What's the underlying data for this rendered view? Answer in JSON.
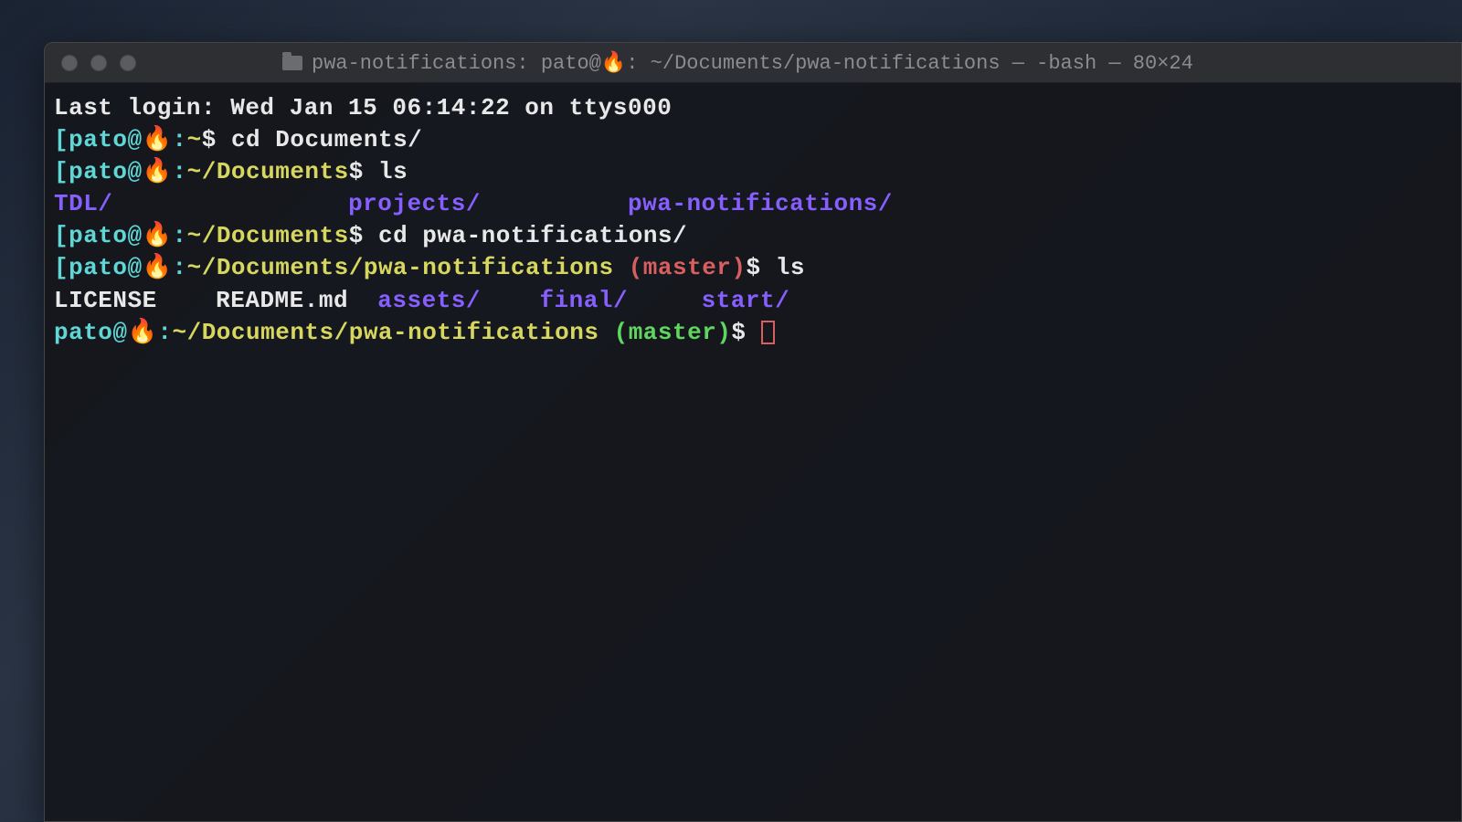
{
  "titlebar": {
    "title_prefix": "pwa-notifications: pato@",
    "fire_emoji": "🔥",
    "title_suffix": ": ~/Documents/pwa-notifications — -bash — 80×24"
  },
  "lines": {
    "last_login": "Last login: Wed Jan 15 06:14:22 on ttys000",
    "l1": {
      "bracket": "[",
      "user": "pato@",
      "emoji": "🔥",
      "colon": ":",
      "path": "~",
      "dollar": "$ ",
      "cmd": "cd Documents/"
    },
    "l2": {
      "bracket": "[",
      "user": "pato@",
      "emoji": "🔥",
      "colon": ":",
      "path": "~/Documents",
      "dollar": "$ ",
      "cmd": "ls"
    },
    "ls1": {
      "item1": "TDL/",
      "item2": "projects/",
      "item3": "pwa-notifications/",
      "sp1": "                ",
      "sp2": "          ",
      "sl": "/"
    },
    "l3": {
      "bracket": "[",
      "user": "pato@",
      "emoji": "🔥",
      "colon": ":",
      "path": "~/Documents",
      "dollar": "$ ",
      "cmd": "cd pwa-notifications/"
    },
    "l4": {
      "bracket": "[",
      "user": "pato@",
      "emoji": "🔥",
      "colon": ":",
      "path": "~/Documents/pwa-notifications",
      "branch": " (master)",
      "dollar": "$ ",
      "cmd": "ls"
    },
    "ls2": {
      "item1": "LICENSE",
      "item2": "README.md",
      "item3": "assets/",
      "item4": "final/",
      "item5": "start/",
      "sp1": "    ",
      "sp2": "  ",
      "sp3": "    ",
      "sp4": "     "
    },
    "l5": {
      "user": "pato@",
      "emoji": "🔥",
      "colon": ":",
      "path": "~/Documents/pwa-notifications",
      "branch": " (master)",
      "dollar": "$ "
    }
  }
}
